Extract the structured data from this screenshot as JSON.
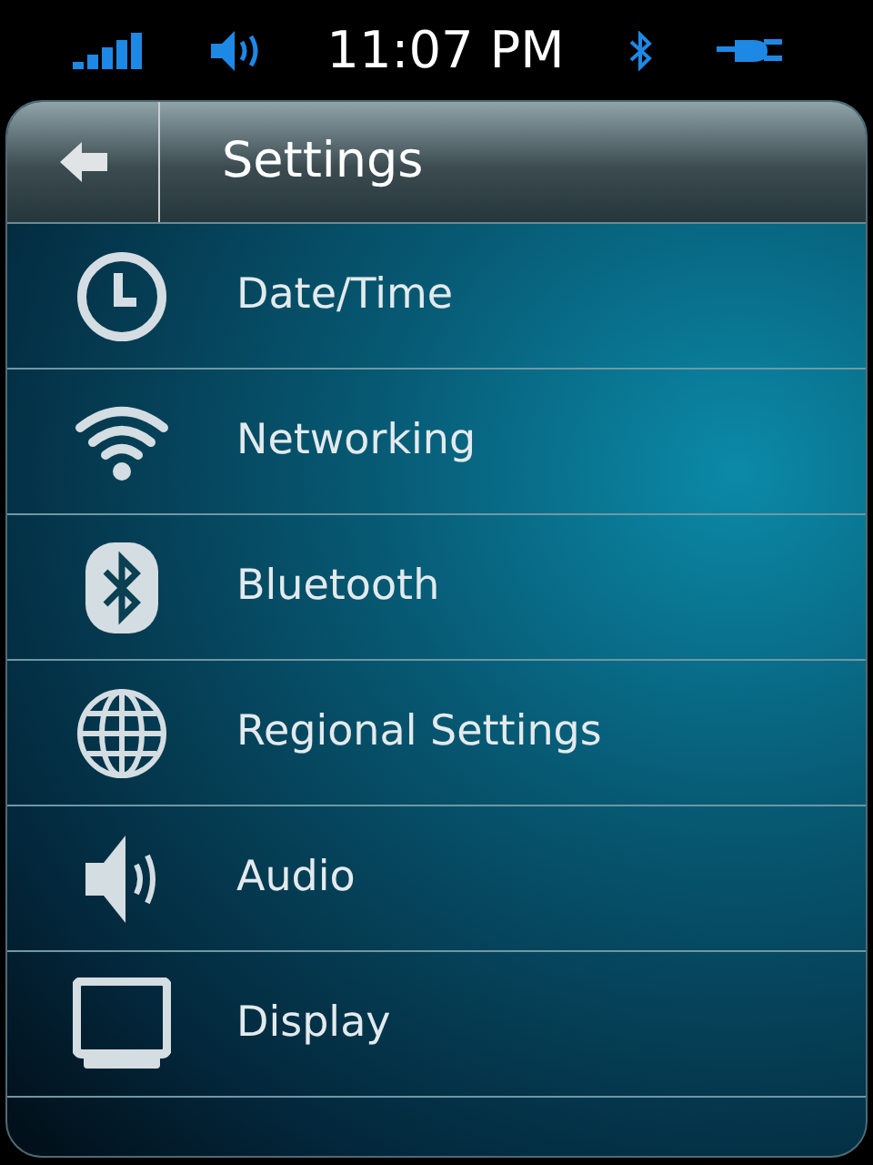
{
  "status_bar": {
    "time": "11:07 PM"
  },
  "header": {
    "title": "Settings"
  },
  "menu": [
    {
      "label": "Date/Time"
    },
    {
      "label": "Networking"
    },
    {
      "label": "Bluetooth"
    },
    {
      "label": "Regional Settings"
    },
    {
      "label": "Audio"
    },
    {
      "label": "Display"
    }
  ]
}
